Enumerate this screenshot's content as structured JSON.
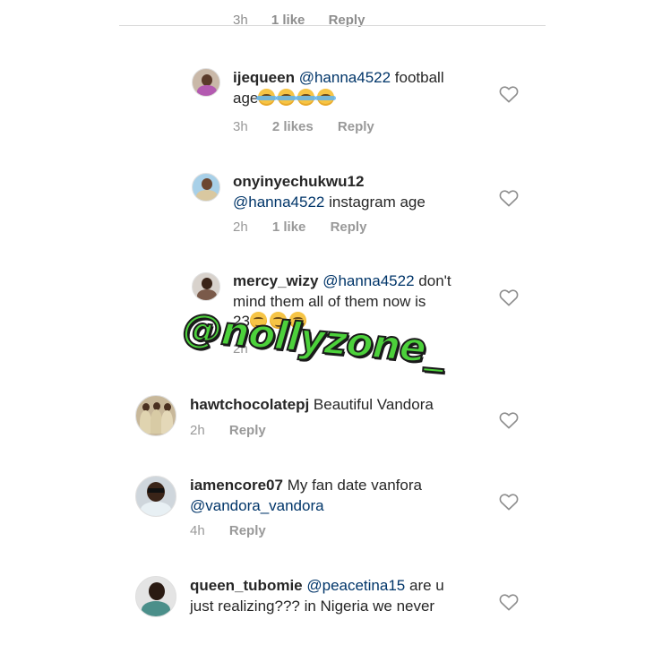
{
  "top_partial": {
    "time": "3h",
    "likes": "1 like",
    "reply": "Reply"
  },
  "comments": [
    {
      "username": "ijequeen",
      "mention": "@hanna4522",
      "text_line1": "football",
      "text_line2": "age",
      "emoji": [
        "face-with-tears-of-joy",
        "face-with-tears-of-joy",
        "face-with-tears-of-joy",
        "face-with-tears-of-joy"
      ],
      "time": "3h",
      "likes": "2 likes",
      "reply": "Reply"
    },
    {
      "username": "onyinyechukwu12",
      "mention": "@hanna4522",
      "text_line2": "instagram age",
      "time": "2h",
      "likes": "1 like",
      "reply": "Reply"
    },
    {
      "username": "mercy_wizy",
      "mention": "@hanna4522",
      "text_line1": "don't",
      "text_line2": "mind them all of them now is",
      "text_line3": "23",
      "emoji": [
        "smirking-face",
        "smirking-face",
        "smirking-face"
      ],
      "time": "2h"
    },
    {
      "username": "hawtchocolatepj",
      "text_line1": "Beautiful Vandora",
      "time": "2h",
      "reply": "Reply"
    },
    {
      "username": "iamencore07",
      "text_line1": "My fan date vanfora",
      "mention2": "@vandora_vandora",
      "time": "4h",
      "reply": "Reply"
    },
    {
      "username": "queen_tubomie",
      "mention": "@peacetina15",
      "text_line1": "are u",
      "text_line2": "just realizing??? in Nigeria we never"
    }
  ],
  "watermark": "@nollyzone_",
  "icons": {
    "like": "heart-outline-icon"
  },
  "colors": {
    "mention": "#003569",
    "meta": "#999999",
    "watermark": "#4cd13b"
  }
}
